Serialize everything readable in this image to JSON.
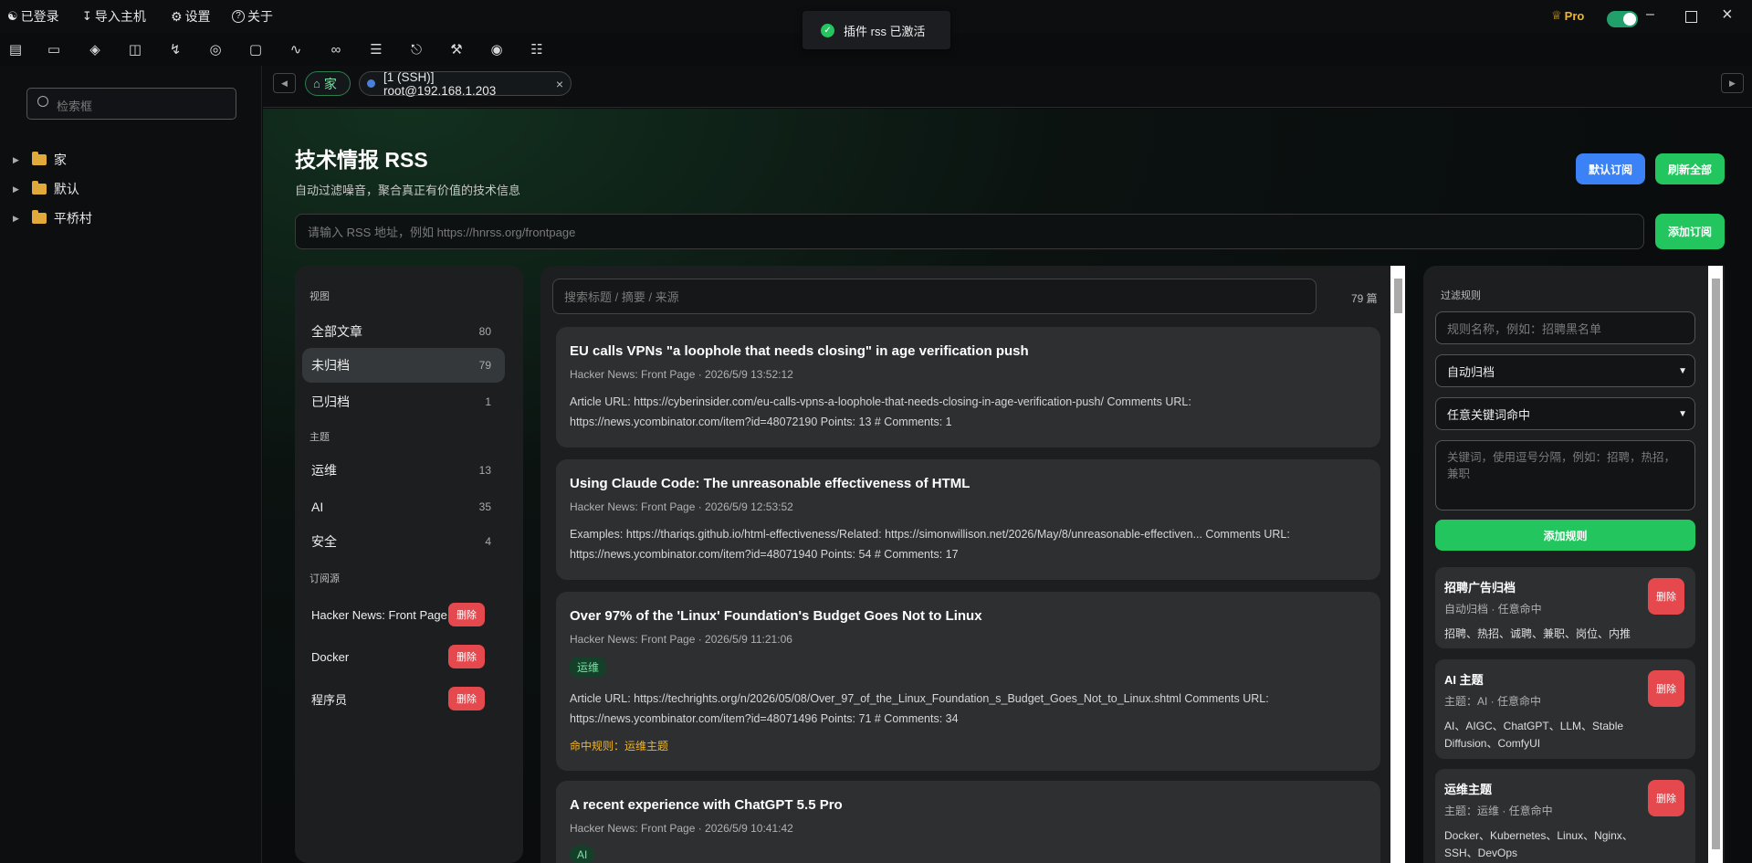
{
  "topbar": {
    "login": "已登录",
    "import": "导入主机",
    "settings": "设置",
    "about": "关于",
    "pro": "Pro"
  },
  "toast": {
    "text": "插件 rss 已激活"
  },
  "sidebar": {
    "search_placeholder": "检索框",
    "items": [
      {
        "label": "家"
      },
      {
        "label": "默认"
      },
      {
        "label": "平桥村"
      }
    ]
  },
  "tabs": [
    {
      "label": "家",
      "icon": "home-icon"
    },
    {
      "label": "[1 (SSH)] root@192.168.1.203"
    }
  ],
  "header": {
    "title": "技术情报 RSS",
    "subtitle": "自动过滤噪音，聚合真正有价值的技术信息",
    "default_sub": "默认订阅",
    "refresh_all": "刷新全部",
    "url_placeholder": "请输入 RSS 地址，例如 https://hnrss.org/frontpage",
    "add_sub": "添加订阅"
  },
  "left_panel": {
    "view_title": "视图",
    "views": [
      {
        "label": "全部文章",
        "count": "80"
      },
      {
        "label": "未归档",
        "count": "79"
      },
      {
        "label": "已归档",
        "count": "1"
      }
    ],
    "topic_title": "主题",
    "topics": [
      {
        "label": "运维",
        "count": "13"
      },
      {
        "label": "AI",
        "count": "35"
      },
      {
        "label": "安全",
        "count": "4"
      }
    ],
    "source_title": "订阅源",
    "sources": [
      {
        "label": "Hacker News: Front Page",
        "del": "删除"
      },
      {
        "label": "Docker",
        "del": "删除"
      },
      {
        "label": "程序员",
        "del": "删除"
      }
    ]
  },
  "articles": {
    "search_placeholder": "搜索标题 / 摘要 / 来源",
    "count": "79 篇",
    "items": [
      {
        "title": "EU calls VPNs \"a loophole that needs closing\" in age verification push",
        "meta": "Hacker News: Front Page · 2026/5/9 13:52:12",
        "body": "Article URL: https://cyberinsider.com/eu-calls-vpns-a-loophole-that-needs-closing-in-age-verification-push/ Comments URL: https://news.ycombinator.com/item?id=48072190 Points: 13 # Comments: 1"
      },
      {
        "title": "Using Claude Code: The unreasonable effectiveness of HTML",
        "meta": "Hacker News: Front Page · 2026/5/9 12:53:52",
        "body": "Examples: https://thariqs.github.io/html-effectiveness/Related: https://simonwillison.net/2026/May/8/unreasonable-effectiven... Comments URL: https://news.ycombinator.com/item?id=48071940 Points: 54 # Comments: 17"
      },
      {
        "title": "Over 97% of the 'Linux' Foundation's Budget Goes Not to Linux",
        "meta": "Hacker News: Front Page · 2026/5/9 11:21:06",
        "tag": "运维",
        "body": "Article URL: https://techrights.org/n/2026/05/08/Over_97_of_the_Linux_Foundation_s_Budget_Goes_Not_to_Linux.shtml Comments URL: https://news.ycombinator.com/item?id=48071496 Points: 71 # Comments: 34",
        "hit": "命中规则：运维主题"
      },
      {
        "title": "A recent experience with ChatGPT 5.5 Pro",
        "meta": "Hacker News: Front Page · 2026/5/9 10:41:42",
        "tag": "AI"
      }
    ]
  },
  "rules_panel": {
    "title": "过滤规则",
    "name_placeholder": "规则名称，例如：招聘黑名单",
    "action_select": "自动归档",
    "match_select": "任意关键词命中",
    "keywords_placeholder": "关键词，使用逗号分隔，例如：招聘，热招，兼职",
    "add_rule": "添加规则",
    "rules": [
      {
        "title": "招聘广告归档",
        "meta": "自动归档 · 任意命中",
        "keywords": "招聘、热招、诚聘、兼职、岗位、内推",
        "del": "删除"
      },
      {
        "title": "AI 主题",
        "meta": "主题：AI · 任意命中",
        "keywords": "AI、AIGC、ChatGPT、LLM、Stable Diffusion、ComfyUI",
        "del": "删除"
      },
      {
        "title": "运维主题",
        "meta": "主题：运维 · 任意命中",
        "keywords": "Docker、Kubernetes、Linux、Nginx、SSH、DevOps",
        "del": "删除"
      }
    ]
  },
  "colors": {
    "accent_green": "#22c55e",
    "accent_blue": "#3b82f6",
    "danger": "#e5484d",
    "pro_gold": "#f0b429"
  }
}
